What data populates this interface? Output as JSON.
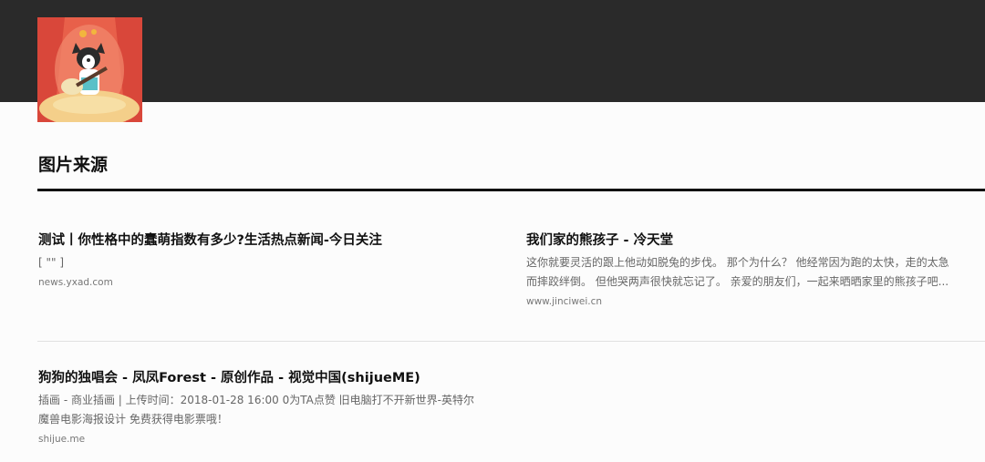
{
  "section": {
    "title": "图片来源"
  },
  "results": [
    {
      "title": "测试丨你性格中的蠢萌指数有多少?生活热点新闻-今日关注",
      "snippet_lines": [
        "[ \"\" ]"
      ],
      "url": "news.yxad.com"
    },
    {
      "title": "我们家的熊孩子 - 冷天堂",
      "snippet_lines": [
        "这你就要灵活的跟上他动如脱兔的步伐。 那个为什么？ 他经常因为跑的太快，走的太急",
        "而摔跤绊倒。 但他哭两声很快就忘记了。 亲爱的朋友们，一起来晒晒家里的熊孩子吧..."
      ],
      "url": "www.jinciwei.cn"
    },
    {
      "title": "狗狗的独唱会 - 凤凤Forest - 原创作品 - 视觉中国(shijueME)",
      "snippet_lines": [
        "插画 - 商业插画 | 上传时间：2018-01-28 16:00 0为TA点赞 旧电脑打不开新世界-英特尔",
        "魔兽电影海报设计 免费获得电影票哦！"
      ],
      "url": "shijue.me"
    }
  ],
  "colors": {
    "topbar": "#2a2a2a",
    "accent_rule": "#111111",
    "thumb_bg": "#e65a44"
  },
  "icons": {
    "thumbnail": "dog-guitar-illustration"
  }
}
